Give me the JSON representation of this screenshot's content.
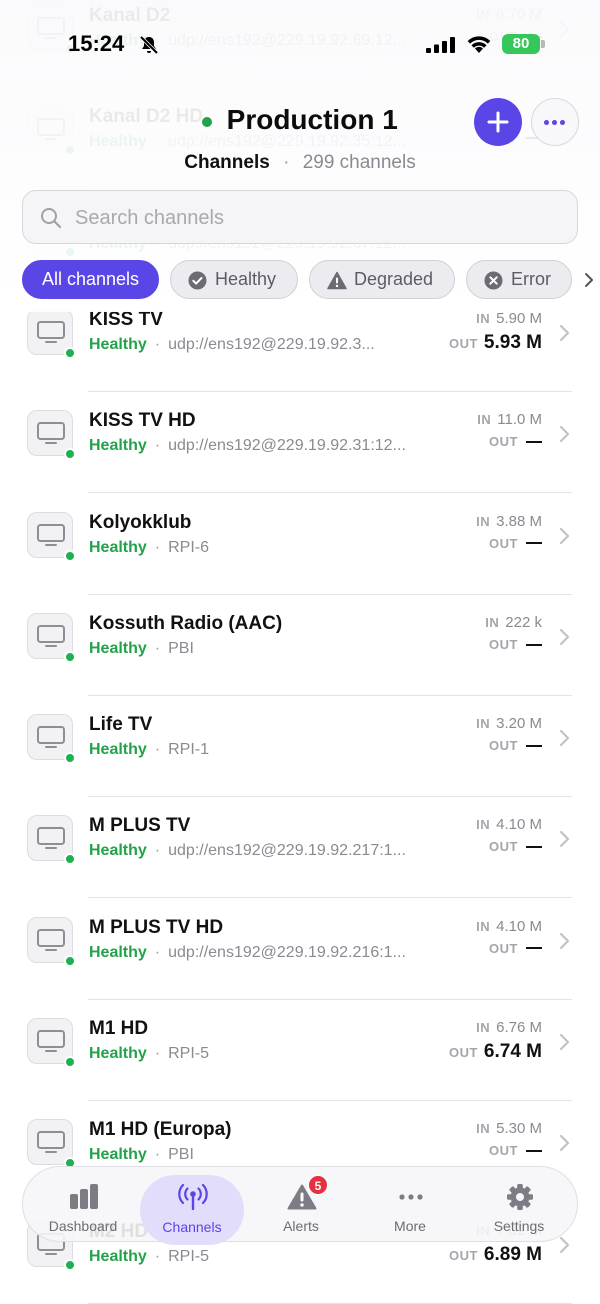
{
  "status_bar": {
    "time": "15:24",
    "battery": "80"
  },
  "header": {
    "title": "Production 1",
    "subtitle_section": "Channels",
    "subtitle_sep": "·",
    "subtitle_count": "299 channels"
  },
  "search": {
    "placeholder": "Search channels",
    "value": ""
  },
  "filters": [
    {
      "label": "All channels",
      "active": true
    },
    {
      "label": "Healthy",
      "icon": "check-circle-icon"
    },
    {
      "label": "Degraded",
      "icon": "warning-triangle-icon"
    },
    {
      "label": "Error",
      "icon": "x-circle-icon"
    }
  ],
  "labels": {
    "in": "IN",
    "out": "OUT",
    "sep": "·"
  },
  "accent_color": "#5a45e6",
  "healthy_color": "#22a24a",
  "channels": [
    {
      "name": "Kanal D2",
      "status": "Healthy",
      "source": "udp://ens192@229.19.92.69:12...",
      "in": "6.70 M",
      "out": ""
    },
    {
      "name": "Kanal D2 HD",
      "status": "Healthy",
      "source": "udp://ens192@229.19.92.35:12...",
      "in": "",
      "out": ""
    },
    {
      "name": "",
      "status": "Healthy",
      "source": "udp://ens192@229.19.92.67:12...",
      "in": "",
      "out": ""
    },
    {
      "name": "KISS TV",
      "status": "Healthy",
      "source": "udp://ens192@229.19.92.3...",
      "in": "5.90 M",
      "out": "5.93 M"
    },
    {
      "name": "KISS TV HD",
      "status": "Healthy",
      "source": "udp://ens192@229.19.92.31:12...",
      "in": "11.0 M",
      "out": ""
    },
    {
      "name": "Kolyokklub",
      "status": "Healthy",
      "source": "RPI-6",
      "in": "3.88 M",
      "out": ""
    },
    {
      "name": "Kossuth Radio (AAC)",
      "status": "Healthy",
      "source": "PBI",
      "in": "222 k",
      "out": ""
    },
    {
      "name": "Life TV",
      "status": "Healthy",
      "source": "RPI-1",
      "in": "3.20 M",
      "out": ""
    },
    {
      "name": "M PLUS TV",
      "status": "Healthy",
      "source": "udp://ens192@229.19.92.217:1...",
      "in": "4.10 M",
      "out": ""
    },
    {
      "name": "M PLUS TV HD",
      "status": "Healthy",
      "source": "udp://ens192@229.19.92.216:1...",
      "in": "4.10 M",
      "out": ""
    },
    {
      "name": "M1 HD",
      "status": "Healthy",
      "source": "RPI-5",
      "in": "6.76 M",
      "out": "6.74 M"
    },
    {
      "name": "M1 HD (Europa)",
      "status": "Healthy",
      "source": "PBI",
      "in": "5.30 M",
      "out": ""
    },
    {
      "name": "M2 HD",
      "status": "Healthy",
      "source": "RPI-5",
      "in": "7.02 M",
      "out": "6.89 M"
    }
  ],
  "tabs": [
    {
      "label": "Dashboard",
      "icon": "bar-chart-icon"
    },
    {
      "label": "Channels",
      "icon": "broadcast-icon",
      "active": true
    },
    {
      "label": "Alerts",
      "icon": "warning-icon",
      "badge": "5"
    },
    {
      "label": "More",
      "icon": "ellipsis-icon"
    },
    {
      "label": "Settings",
      "icon": "gear-icon"
    }
  ]
}
